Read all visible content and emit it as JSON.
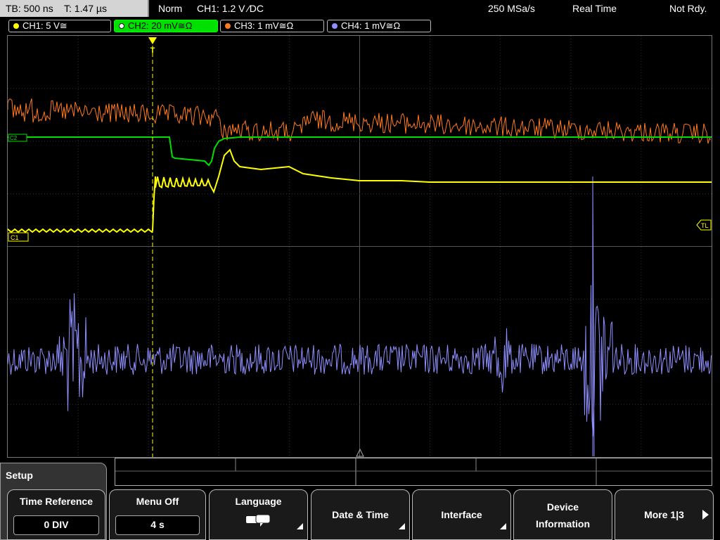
{
  "status_bar": {
    "timebase": "TB: 500 ns",
    "trigger_time": "T: 1.47 µs",
    "mode": "Norm",
    "trigger_source": "CH1: 1.2 V ⁄DC",
    "sample_rate": "250 MSa/s",
    "acq_mode": "Real Time",
    "ready_state": "Not Rdy."
  },
  "channels": [
    {
      "label": "CH1: 5 V≅",
      "color": "#ffff00"
    },
    {
      "label": "CH2: 20 mV≅Ω",
      "color": "#00e000"
    },
    {
      "label": "CH3: 1 mV≅Ω",
      "color": "#ff7a20"
    },
    {
      "label": "CH4: 1 mV≅Ω",
      "color": "#8f8fff"
    }
  ],
  "markers": {
    "trigger": "T",
    "trigger_level": "TL",
    "ch1_ref": "C1",
    "ch2_ref": "C2"
  },
  "menu": {
    "title": "Setup",
    "softkeys": [
      {
        "title": "Time Reference",
        "value": "0 DIV"
      },
      {
        "title": "Menu Off",
        "value": "4 s"
      },
      {
        "title": "Language",
        "icon": "speech-bubbles-icon"
      },
      {
        "title": "Date & Time"
      },
      {
        "title": "Interface"
      },
      {
        "title_line1": "Device",
        "title_line2": "Information"
      },
      {
        "title": "More 1|3"
      }
    ]
  }
}
